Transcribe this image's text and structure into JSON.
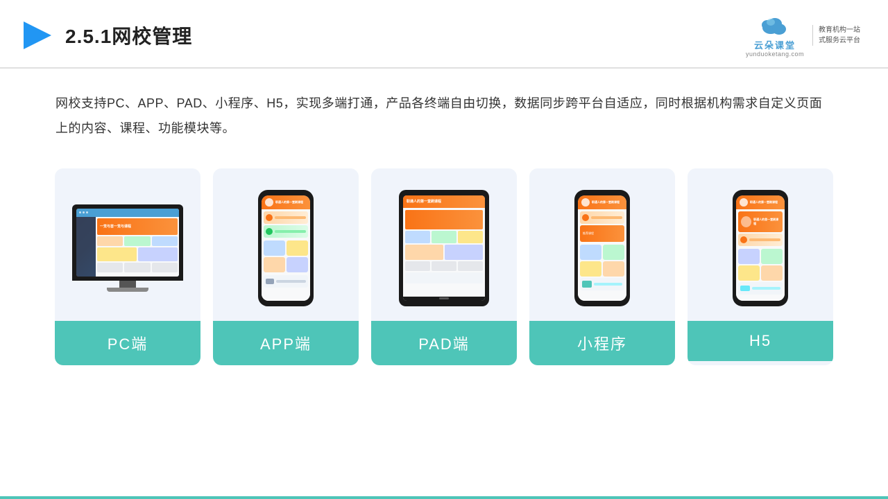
{
  "header": {
    "title": "2.5.1网校管理",
    "logo_cn": "云朵课堂",
    "logo_en": "yunduoketang.com",
    "slogan_line1": "教育机构一站",
    "slogan_line2": "式服务云平台"
  },
  "description": {
    "text": "网校支持PC、APP、PAD、小程序、H5，实现多端打通，产品各终端自由切换，数据同步跨平台自适应，同时根据机构需求自定义页面上的内容、课程、功能模块等。"
  },
  "cards": [
    {
      "id": "pc",
      "label": "PC端"
    },
    {
      "id": "app",
      "label": "APP端"
    },
    {
      "id": "pad",
      "label": "PAD端"
    },
    {
      "id": "miniapp",
      "label": "小程序"
    },
    {
      "id": "h5",
      "label": "H5"
    }
  ]
}
